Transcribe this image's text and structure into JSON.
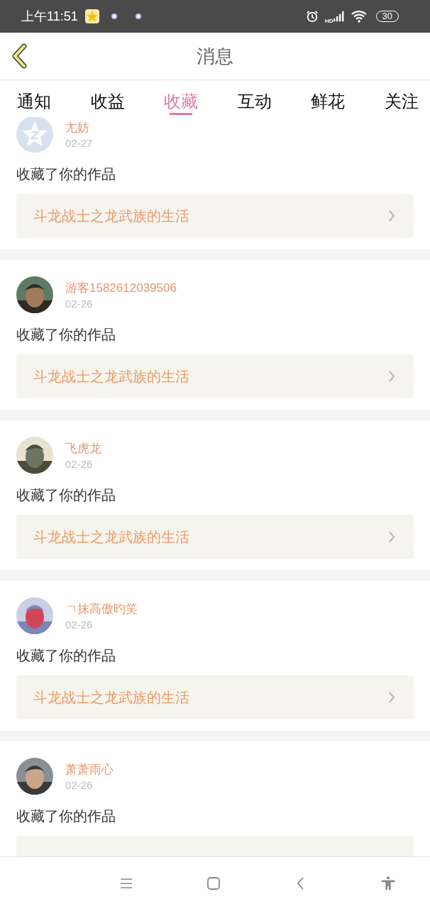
{
  "status_bar": {
    "time": "上午11:51",
    "network": "HD",
    "battery": "30"
  },
  "header": {
    "title": "消息"
  },
  "tabs": [
    {
      "label": "通知",
      "selected": false
    },
    {
      "label": "收益",
      "selected": false
    },
    {
      "label": "收藏",
      "selected": true
    },
    {
      "label": "互动",
      "selected": false
    },
    {
      "label": "鲜花",
      "selected": false
    },
    {
      "label": "关注",
      "selected": false
    }
  ],
  "messages": [
    {
      "avatar": {
        "kind": "default"
      },
      "name": "尢妨",
      "date": "02-27",
      "action": "收藏了你的作品",
      "work_title": "斗龙战士之龙武族的生活"
    },
    {
      "name": "游客1582612039506",
      "date": "02-26",
      "action": "收藏了你的作品",
      "work_title": "斗龙战士之龙武族的生活"
    },
    {
      "name": "飞虎龙",
      "date": "02-26",
      "action": "收藏了你的作品",
      "work_title": "斗龙战士之龙武族的生活"
    },
    {
      "name": "ㄱ抹高傲旳笑",
      "date": "02-26",
      "action": "收藏了你的作品",
      "work_title": "斗龙战士之龙武族的生活"
    },
    {
      "name": "萧萧雨心",
      "date": "02-26",
      "action": "收藏了你的作品"
    }
  ]
}
